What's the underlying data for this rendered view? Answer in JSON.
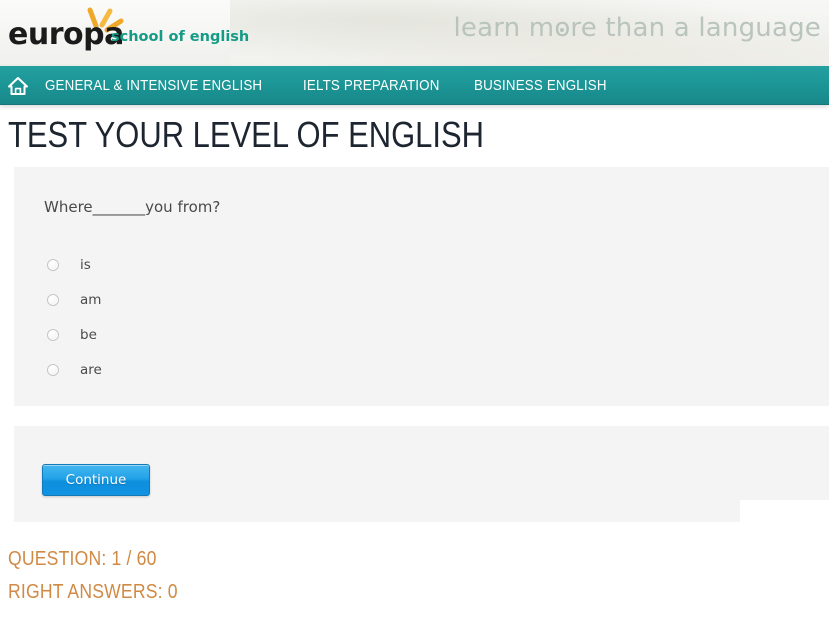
{
  "header": {
    "logo_word": "europa",
    "logo_sub": "school of english",
    "tagline_before": "learn m",
    "tagline_o": "o",
    "tagline_after": "re than a language",
    "tagline_full": "learn more than a language",
    "sunburst_color": "#f0a828",
    "brand_teal": "#149b86"
  },
  "nav": {
    "home_label": "Home",
    "items": [
      {
        "label": "GENERAL & INTENSIVE ENGLISH"
      },
      {
        "label": "IELTS PREPARATION"
      },
      {
        "label": "BUSINESS ENGLISH"
      }
    ],
    "background_color": "#1d9797"
  },
  "page": {
    "title": "TEST YOUR LEVEL OF ENGLISH"
  },
  "quiz": {
    "question_text": "Where_______you from?",
    "options": [
      {
        "label": "is",
        "selected": false
      },
      {
        "label": "am",
        "selected": false
      },
      {
        "label": "be",
        "selected": false
      },
      {
        "label": "are",
        "selected": false
      }
    ],
    "continue_label": "Continue"
  },
  "status": {
    "question_line": "QUESTION: 1 / 60",
    "right_answers_line": "RIGHT ANSWERS: 0",
    "color": "#d08a45"
  }
}
